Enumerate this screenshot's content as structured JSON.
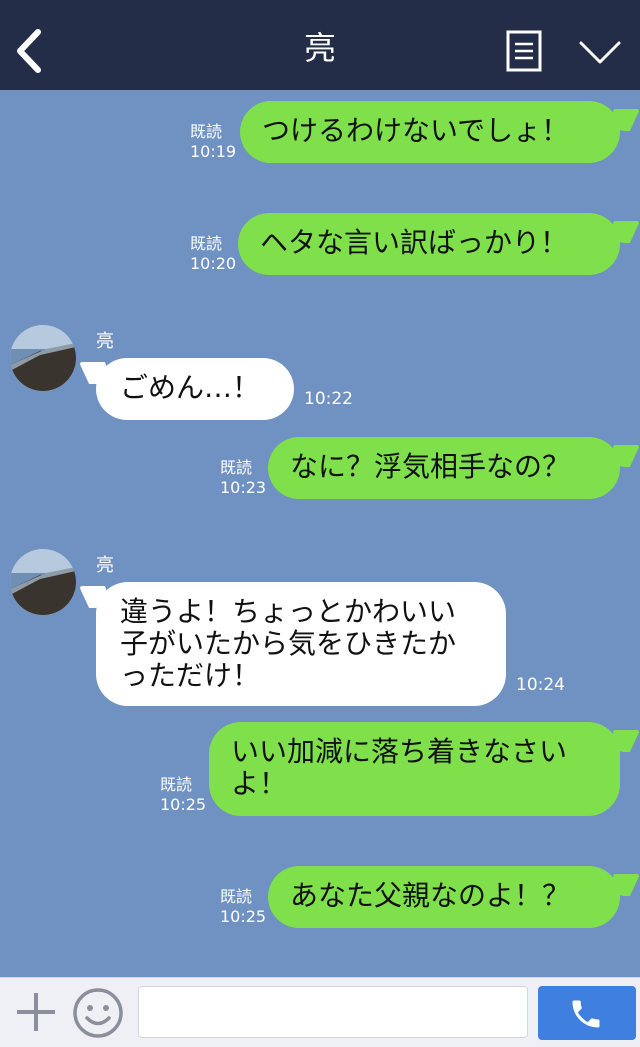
{
  "header": {
    "title": "亮"
  },
  "messages": [
    {
      "kind": "sent",
      "read": "既読",
      "time": "10:19",
      "lines": [
        "つけるわけないでしょ！"
      ]
    },
    {
      "kind": "sent",
      "read": "既読",
      "time": "10:20",
      "lines": [
        "ヘタな言い訳ばっかり！"
      ]
    },
    {
      "kind": "received",
      "sender": "亮",
      "time": "10:22",
      "lines": [
        "ごめん…！"
      ]
    },
    {
      "kind": "sent",
      "read": "既読",
      "time": "10:23",
      "lines": [
        "なに？浮気相手なの？"
      ]
    },
    {
      "kind": "received",
      "sender": "亮",
      "time": "10:24",
      "lines": [
        "違うよ！ちょっとかわいい",
        "子がいたから気をひきたか",
        "っただけ！"
      ]
    },
    {
      "kind": "sent",
      "read": "既読",
      "time": "10:25",
      "lines": [
        "いい加減に落ち着きなさい",
        "よ！"
      ]
    },
    {
      "kind": "sent",
      "read": "既読",
      "time": "10:25",
      "lines": [
        "あなた父親なのよ！？"
      ]
    }
  ],
  "input": {
    "value": "",
    "placeholder": ""
  },
  "icons": {
    "back": "back-chevron-icon",
    "menu": "menu-list-icon",
    "collapse": "chevron-down-icon",
    "avatar": "profile-photo-seaside",
    "plus": "plus-icon",
    "emoji": "emoji-icon",
    "call": "phone-icon"
  },
  "colors": {
    "header_bg": "#232d48",
    "chat_bg": "#7092c2",
    "sent_bubble": "#7fe04c",
    "received_bubble": "#ffffff",
    "call_button": "#3f7fe0"
  }
}
